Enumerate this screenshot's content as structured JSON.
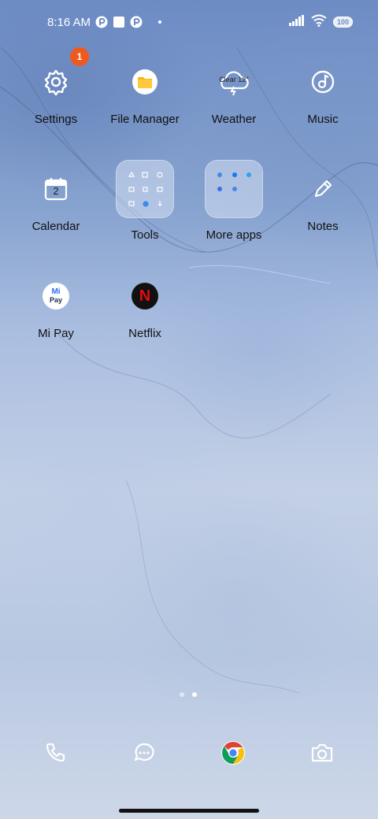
{
  "status_bar": {
    "time": "8:16 AM",
    "battery": "100",
    "icons": [
      "auth-app-icon",
      "square-notification-icon",
      "auth-app-icon",
      "dot-icon",
      "signal-icon",
      "wifi-icon",
      "battery-icon"
    ]
  },
  "home": {
    "apps": [
      {
        "label": "Settings",
        "icon": "gear-icon",
        "badge": "1"
      },
      {
        "label": "File Manager",
        "icon": "folder-icon"
      },
      {
        "label": "Weather",
        "icon": "weather-cloud-icon",
        "icon_text": "Clear 12°"
      },
      {
        "label": "Music",
        "icon": "music-disc-icon"
      },
      {
        "label": "Calendar",
        "icon": "calendar-icon",
        "icon_text": "2"
      },
      {
        "label": "Tools",
        "icon": "folder-grid-icon"
      },
      {
        "label": "More apps",
        "icon": "folder-grid-icon"
      },
      {
        "label": "Notes",
        "icon": "pencil-icon"
      },
      {
        "label": "Mi Pay",
        "icon": "mi-pay-icon",
        "icon_text_top": "Mi",
        "icon_text_bottom": "Pay"
      },
      {
        "label": "Netflix",
        "icon": "netflix-icon",
        "icon_text": "N"
      }
    ]
  },
  "pager": {
    "pages": 2,
    "active": 2
  },
  "dock": {
    "icons": [
      "phone-icon",
      "messages-icon",
      "chrome-icon",
      "camera-icon"
    ]
  },
  "colors": {
    "badge": "#ef5a1c",
    "netflix_red": "#e50914",
    "file_manager_yellow": "#f6b417"
  }
}
